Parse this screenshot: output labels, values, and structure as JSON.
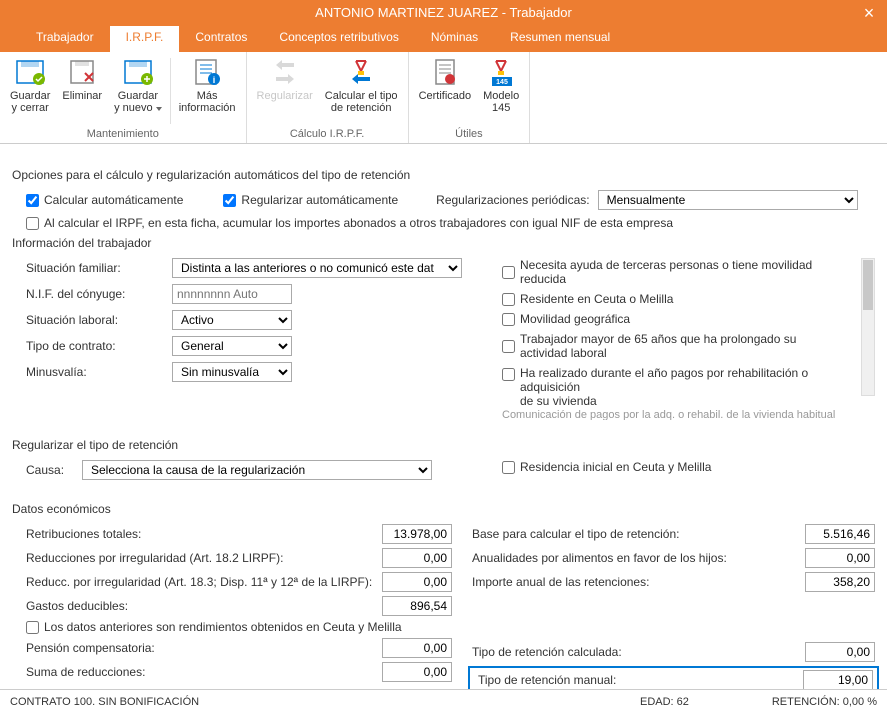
{
  "window": {
    "title": "ANTONIO MARTINEZ JUAREZ - Trabajador"
  },
  "tabs": {
    "t0": "Trabajador",
    "t1": "I.R.P.F.",
    "t2": "Contratos",
    "t3": "Conceptos retributivos",
    "t4": "Nóminas",
    "t5": "Resumen mensual"
  },
  "ribbon": {
    "g0": "Mantenimiento",
    "g1": "Cálculo I.R.P.F.",
    "g2": "Útiles",
    "b0a": "Guardar",
    "b0b": "y cerrar",
    "b1a": "Eliminar",
    "b2a": "Guardar",
    "b2b": "y nuevo",
    "b3a": "Más",
    "b3b": "información",
    "b4": "Regularizar",
    "b5a": "Calcular el tipo",
    "b5b": "de retención",
    "b6": "Certificado",
    "b7a": "Modelo",
    "b7b": "145"
  },
  "options": {
    "heading": "Opciones para el cálculo y regularización automáticos del tipo de retención",
    "calc_auto": "Calcular automáticamente",
    "reg_auto": "Regularizar automáticamente",
    "reg_period_label": "Regularizaciones periódicas:",
    "reg_period_value": "Mensualmente",
    "acumular": "Al calcular el IRPF, en esta ficha, acumular los importes abonados a otros trabajadores con igual NIF de esta empresa"
  },
  "info": {
    "heading": "Información del trabajador",
    "sit_fam_label": "Situación familiar:",
    "sit_fam_value": "Distinta a las anteriores o no comunicó este dat",
    "nif_label": "N.I.F. del cónyuge:",
    "nif_placeholder": "nnnnnnnn Auto",
    "sit_lab_label": "Situación laboral:",
    "sit_lab_value": "Activo",
    "tipo_contrato_label": "Tipo de contrato:",
    "tipo_contrato_value": "General",
    "minus_label": "Minusvalía:",
    "minus_value": "Sin minusvalía",
    "chk_ayuda": "Necesita ayuda de terceras personas o tiene movilidad reducida",
    "chk_ceuta": "Residente en Ceuta o Melilla",
    "chk_movgeo": "Movilidad geográfica",
    "chk_mayor65": "Trabajador mayor de 65 años que ha prolongado su actividad laboral",
    "chk_pagos_a": "Ha realizado durante el año pagos por rehabilitación o adquisición",
    "chk_pagos_b": "de su vivienda",
    "chk_cut": "Comunicación de pagos por la adq. o rehabil. de la vivienda habitual"
  },
  "regularizar": {
    "heading": "Regularizar el tipo de retención",
    "causa_label": "Causa:",
    "causa_value": "Selecciona la causa de la regularización",
    "chk_res_ini": "Residencia inicial en Ceuta y Melilla"
  },
  "econ": {
    "heading": "Datos económicos",
    "retrib_total_label": "Retribuciones totales:",
    "retrib_total_value": "13.978,00",
    "red_irreg_label": "Reducciones por irregularidad (Art. 18.2 LIRPF):",
    "red_irreg_value": "0,00",
    "red_irreg2_label": "Reducc. por irregularidad (Art. 18.3; Disp. 11ª y 12ª de la LIRPF):",
    "red_irreg2_value": "0,00",
    "gastos_label": "Gastos deducibles:",
    "gastos_value": "896,54",
    "chk_rend_ceuta": "Los datos anteriores son rendimientos obtenidos en Ceuta y Melilla",
    "pension_label": "Pensión compensatoria:",
    "pension_value": "0,00",
    "suma_label": "Suma de reducciones:",
    "suma_value": "0,00",
    "base_label": "Base para calcular el tipo de retención:",
    "base_value": "5.516,46",
    "anual_label": "Anualidades por alimentos en favor de los hijos:",
    "anual_value": "0,00",
    "imp_anual_label": "Importe anual de las retenciones:",
    "imp_anual_value": "358,20",
    "tipo_calc_label": "Tipo de retención calculada:",
    "tipo_calc_value": "0,00",
    "tipo_manual_label": "Tipo de retención manual:",
    "tipo_manual_value": "19,00"
  },
  "status": {
    "left": "CONTRATO 100.  SIN BONIFICACIÓN",
    "mid": "EDAD: 62",
    "right": "RETENCIÓN: 0,00 %"
  }
}
